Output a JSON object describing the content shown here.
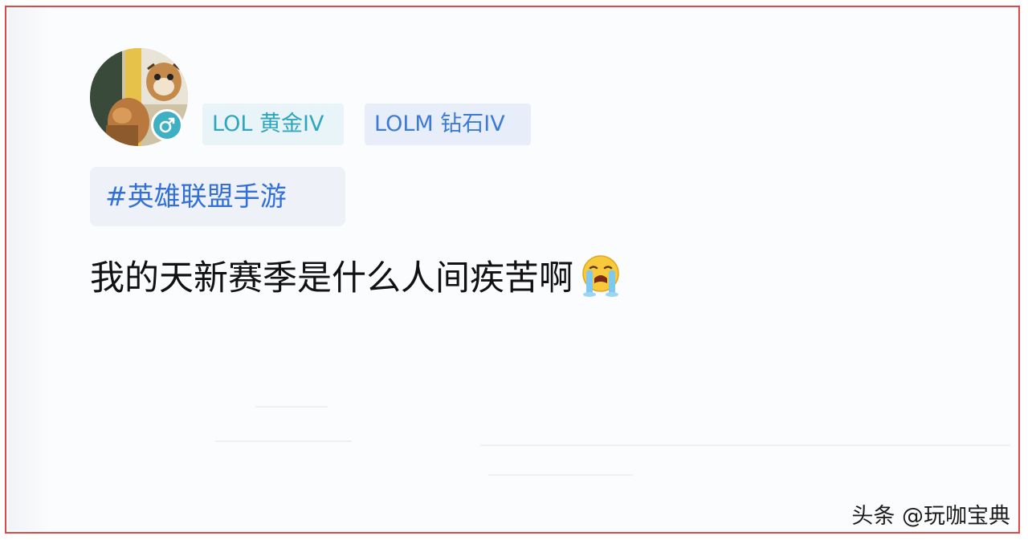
{
  "user": {
    "avatar_icon": "tiger-character-avatar-icon",
    "gender_icon": "male-symbol-icon",
    "gender_color": "#3fb0c4"
  },
  "tags": [
    {
      "label": "LOL 黄金IV",
      "color": "#2ea6be"
    },
    {
      "label": "LOLM 钻石IV",
      "color": "#3b7ad8"
    }
  ],
  "topic": {
    "label": "#英雄联盟手游"
  },
  "post": {
    "text": "我的天新赛季是什么人间疾苦啊",
    "emoji_icon": "crying-face-emoji-icon"
  },
  "watermark": {
    "text": "头条 @玩咖宝典"
  },
  "colors": {
    "frame_border": "#e04848",
    "topic_text": "#3270d8"
  }
}
